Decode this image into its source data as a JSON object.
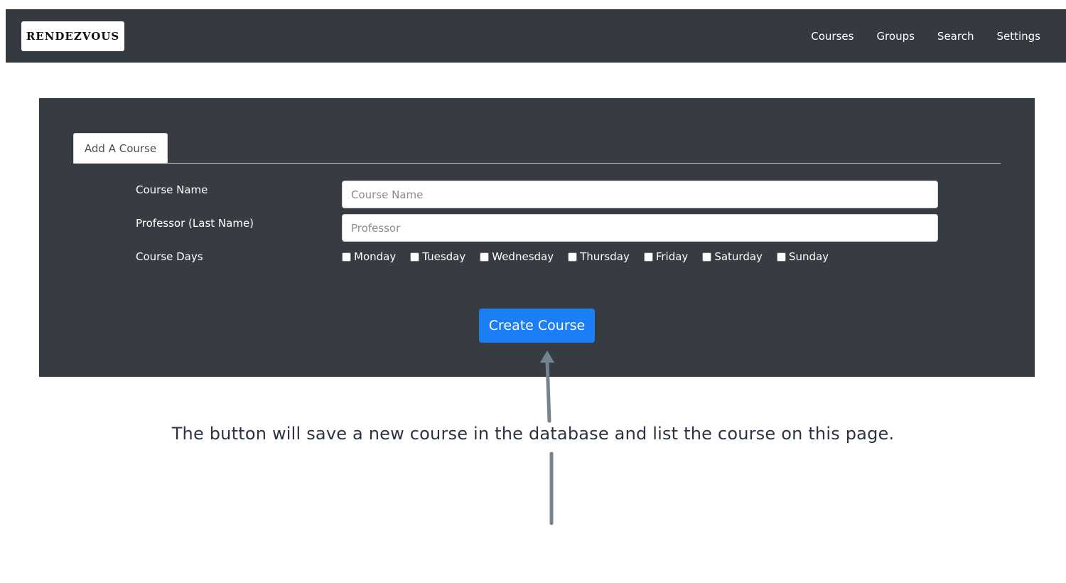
{
  "navbar": {
    "logo_text": "RENDEZVOUS",
    "links": [
      "Courses",
      "Groups",
      "Search",
      "Settings"
    ]
  },
  "form": {
    "tab_label": "Add A Course",
    "course_name_label": "Course Name",
    "course_name_placeholder": "Course Name",
    "professor_label": "Professor (Last Name)",
    "professor_placeholder": "Professor",
    "days_label": "Course Days",
    "days": [
      "Monday",
      "Tuesday",
      "Wednesday",
      "Thursday",
      "Friday",
      "Saturday",
      "Sunday"
    ],
    "submit_label": "Create Course"
  },
  "annotation": {
    "text": "The button will save a new course in the database and list the course on this page."
  },
  "colors": {
    "navbar_bg": "#343a40",
    "card_bg": "#373b42",
    "primary": "#1a7ff5",
    "arrow": "#75828f"
  }
}
